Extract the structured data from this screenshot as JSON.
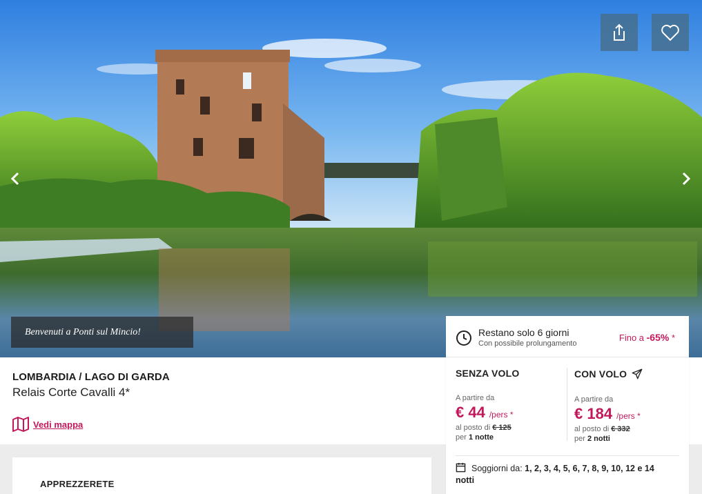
{
  "hero": {
    "caption": "Benvenuti a Ponti sul Mincio!",
    "share_icon": "share-icon",
    "favorite_icon": "heart-icon",
    "prev_icon": "chevron-left-icon",
    "next_icon": "chevron-right-icon"
  },
  "info": {
    "region": "LOMBARDIA / LAGO DI GARDA",
    "hotel": "Relais Corte Cavalli 4*",
    "map_link": "Vedi mappa"
  },
  "section": {
    "title": "APPREZZERETE"
  },
  "offer": {
    "countdown_title": "Restano solo 6 giorni",
    "countdown_sub": "Con possibile prolungamento",
    "discount_prefix": "Fino a ",
    "discount_value": "-65%",
    "discount_suffix": " *",
    "without_flight": {
      "heading": "SENZA VOLO",
      "from": "A partire da",
      "price": "€ 44",
      "per_person": "/pers *",
      "instead_label": "al posto di ",
      "instead_price": "€ 125",
      "per_label": "per ",
      "nights": "1 notte"
    },
    "with_flight": {
      "heading": "CON VOLO",
      "from": "A partire da",
      "price": "€ 184",
      "per_person": "/pers *",
      "instead_label": "al posto di ",
      "instead_price": "€ 332",
      "per_label": "per ",
      "nights": "2 notti"
    },
    "stay_label": "Soggiorni da: ",
    "stay_values": "1, 2, 3, 4, 5, 6, 7, 8, 9, 10, 12 e 14",
    "stay_suffix": "notti"
  },
  "colors": {
    "accent": "#c2185b",
    "button_bg": "#466e8c",
    "band": "#ececec"
  }
}
